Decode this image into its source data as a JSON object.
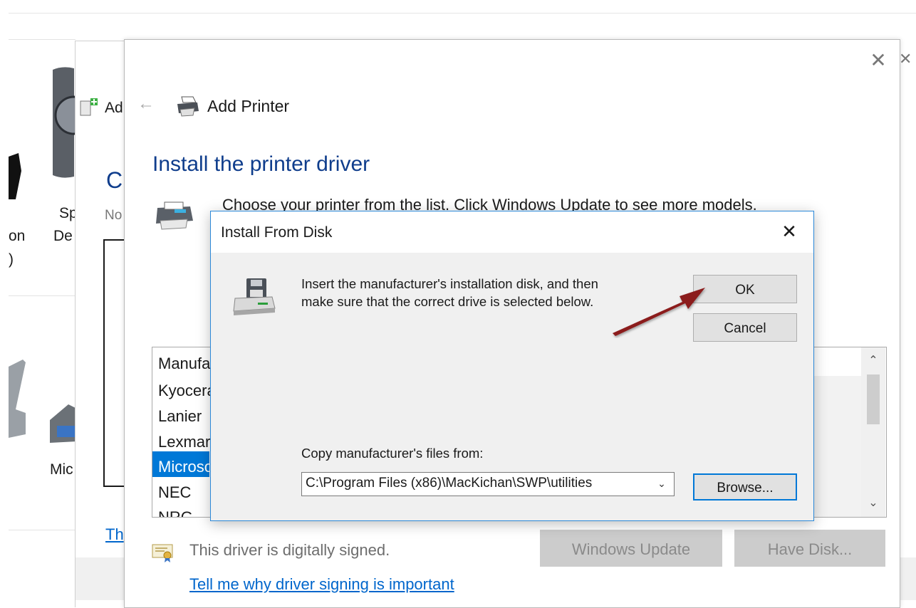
{
  "background_window": {
    "label_on": "on",
    "label_paren": ")",
    "label_sp": "Sp",
    "label_de": "De",
    "label_mic": "Mic"
  },
  "middle_window": {
    "title_partial": "Ad",
    "heading_partial": "Cl",
    "subtitle_partial": "No",
    "link_partial": "Th"
  },
  "wizard": {
    "title": "Add Printer",
    "heading": "Install the printer driver",
    "description": "Choose your printer from the list. Click Windows Update to see more models.",
    "manufacturer_header": "Manufa",
    "manufacturers": [
      "Kyocera",
      "Lanier",
      "Lexmar",
      "Microso",
      "NEC",
      "NRG"
    ],
    "selected_manufacturer_index": 3,
    "signed_text": "This driver is digitally signed.",
    "signing_link": "Tell me why driver signing is important",
    "windows_update_label": "Windows Update",
    "have_disk_label": "Have Disk...",
    "close_glyph": "✕",
    "back_glyph": "←"
  },
  "dialog": {
    "title": "Install From Disk",
    "message_line1": "Insert the manufacturer's installation disk, and then",
    "message_line2": "make sure that the correct drive is selected below.",
    "ok_label": "OK",
    "cancel_label": "Cancel",
    "copy_label": "Copy manufacturer's files from:",
    "path_value": "C:\\Program Files (x86)\\MacKichan\\SWP\\utilities",
    "browse_label": "Browse...",
    "close_glyph": "✕"
  },
  "colors": {
    "accent": "#0078d7",
    "heading": "#0f3d8c",
    "link": "#0066cc",
    "annotation_arrow": "#8b1a1a"
  },
  "icons": {
    "wizard_printer": "printer-icon",
    "driver_printer": "printer-icon",
    "disk": "floppy-disk-drive-icon",
    "certificate": "certificate-icon"
  }
}
